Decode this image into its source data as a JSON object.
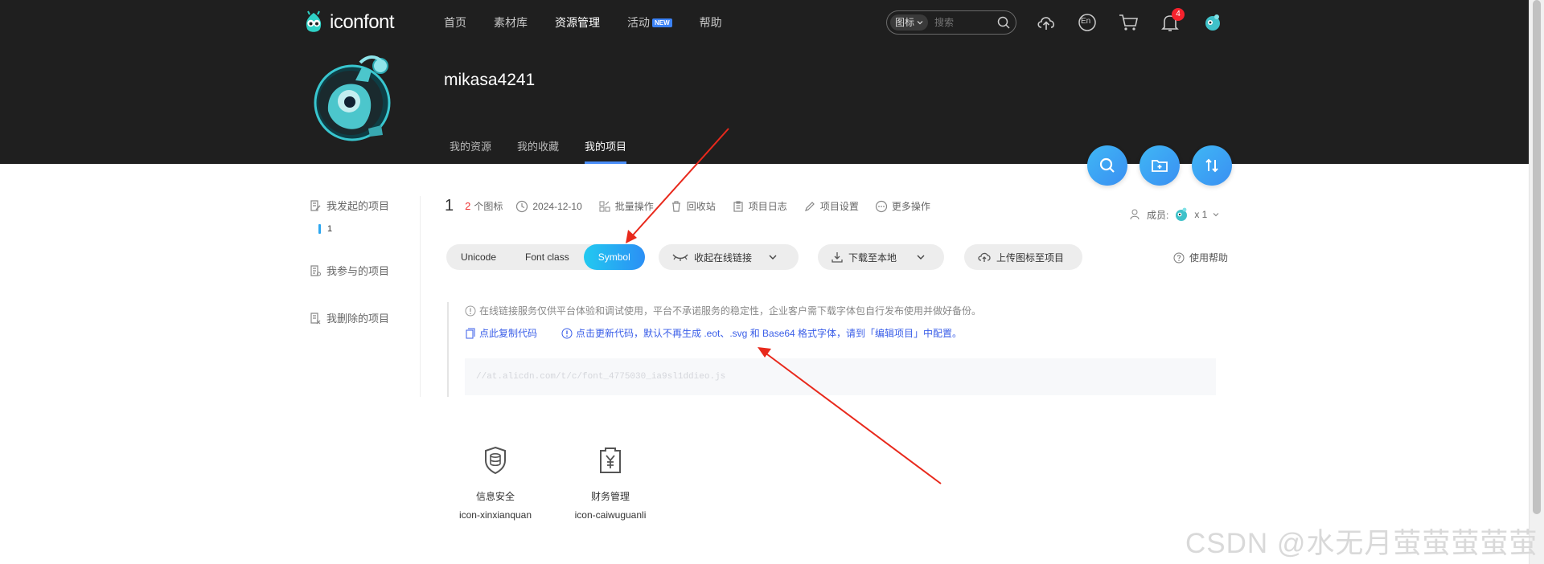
{
  "header": {
    "logo_text": "iconfont",
    "nav": [
      {
        "label": "首页"
      },
      {
        "label": "素材库"
      },
      {
        "label": "资源管理",
        "active": true
      },
      {
        "label": "活动",
        "badge": "NEW"
      },
      {
        "label": "帮助"
      }
    ],
    "search": {
      "type_label": "图标",
      "placeholder": "搜索"
    },
    "notification_count": "4",
    "lang_label": "En"
  },
  "profile": {
    "username": "mikasa4241",
    "tabs": [
      {
        "label": "我的资源"
      },
      {
        "label": "我的收藏"
      },
      {
        "label": "我的项目",
        "active": true
      }
    ]
  },
  "sidebar": {
    "items": [
      {
        "label": "我发起的项目"
      },
      {
        "label": "我参与的项目"
      },
      {
        "label": "我删除的项目"
      }
    ],
    "sub_items": [
      {
        "label": "1"
      }
    ]
  },
  "project": {
    "name": "1",
    "icon_count": "2",
    "icon_count_suffix": "个图标",
    "date": "2024-12-10",
    "actions": [
      {
        "label": "批量操作"
      },
      {
        "label": "回收站"
      },
      {
        "label": "项目日志"
      },
      {
        "label": "项目设置"
      },
      {
        "label": "更多操作"
      }
    ],
    "members_label": "成员:",
    "members_count": "x 1"
  },
  "format_tabs": [
    {
      "label": "Unicode"
    },
    {
      "label": "Font class"
    },
    {
      "label": "Symbol",
      "active": true
    }
  ],
  "buttons": {
    "online_link": "收起在线链接",
    "download": "下载至本地",
    "upload": "上传图标至项目",
    "help": "使用帮助"
  },
  "notice": {
    "disclaimer": "在线链接服务仅供平台体验和调试使用，平台不承诺服务的稳定性，企业客户需下载字体包自行发布使用并做好备份。",
    "copy_code": "点此复制代码",
    "update_code": "点击更新代码，默认不再生成 .eot、.svg 和 Base64 格式字体，请到「编辑项目」中配置。",
    "code_url": "//at.alicdn.com/t/c/font_4775030_ia9sl1ddieo.js"
  },
  "icons": [
    {
      "name": "信息安全",
      "code": "icon-xinxianquan",
      "icon": "database-shield-icon"
    },
    {
      "name": "财务管理",
      "code": "icon-caiwuguanli",
      "icon": "finance-yen-icon"
    }
  ],
  "watermark": "CSDN @水无月萤萤萤萤萤",
  "colors": {
    "header_bg": "#1f1f1f",
    "accent_blue": "#2b8ff5",
    "accent_cyan": "#22c9f0",
    "link_blue": "#3a5ee8",
    "badge_red": "#f5222d",
    "annotation_arrow": "#e8291c"
  }
}
